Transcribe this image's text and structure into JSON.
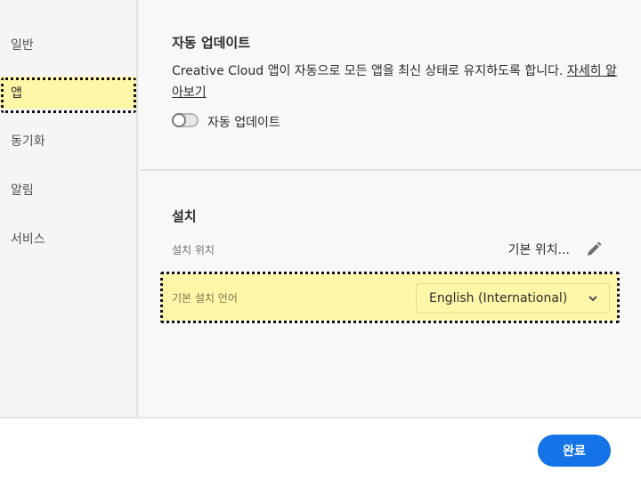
{
  "sidebar": {
    "items": [
      {
        "label": "일반"
      },
      {
        "label": "앱"
      },
      {
        "label": "동기화"
      },
      {
        "label": "알림"
      },
      {
        "label": "서비스"
      }
    ]
  },
  "auto_update": {
    "title": "자동 업데이트",
    "description": "Creative Cloud 앱이 자동으로 모든 앱을 최신 상태로 유지하도록 합니다.",
    "learn_more": "자세히 알아보기",
    "toggle_label": "자동 업데이트"
  },
  "install": {
    "title": "설치",
    "location_label": "설치 위치",
    "location_value": "기본 위치...",
    "language_label": "기본 설치 언어",
    "language_value": "English (International)"
  },
  "footer": {
    "done_label": "완료"
  },
  "colors": {
    "accent": "#1473e6",
    "highlight": "#fff6a8"
  }
}
